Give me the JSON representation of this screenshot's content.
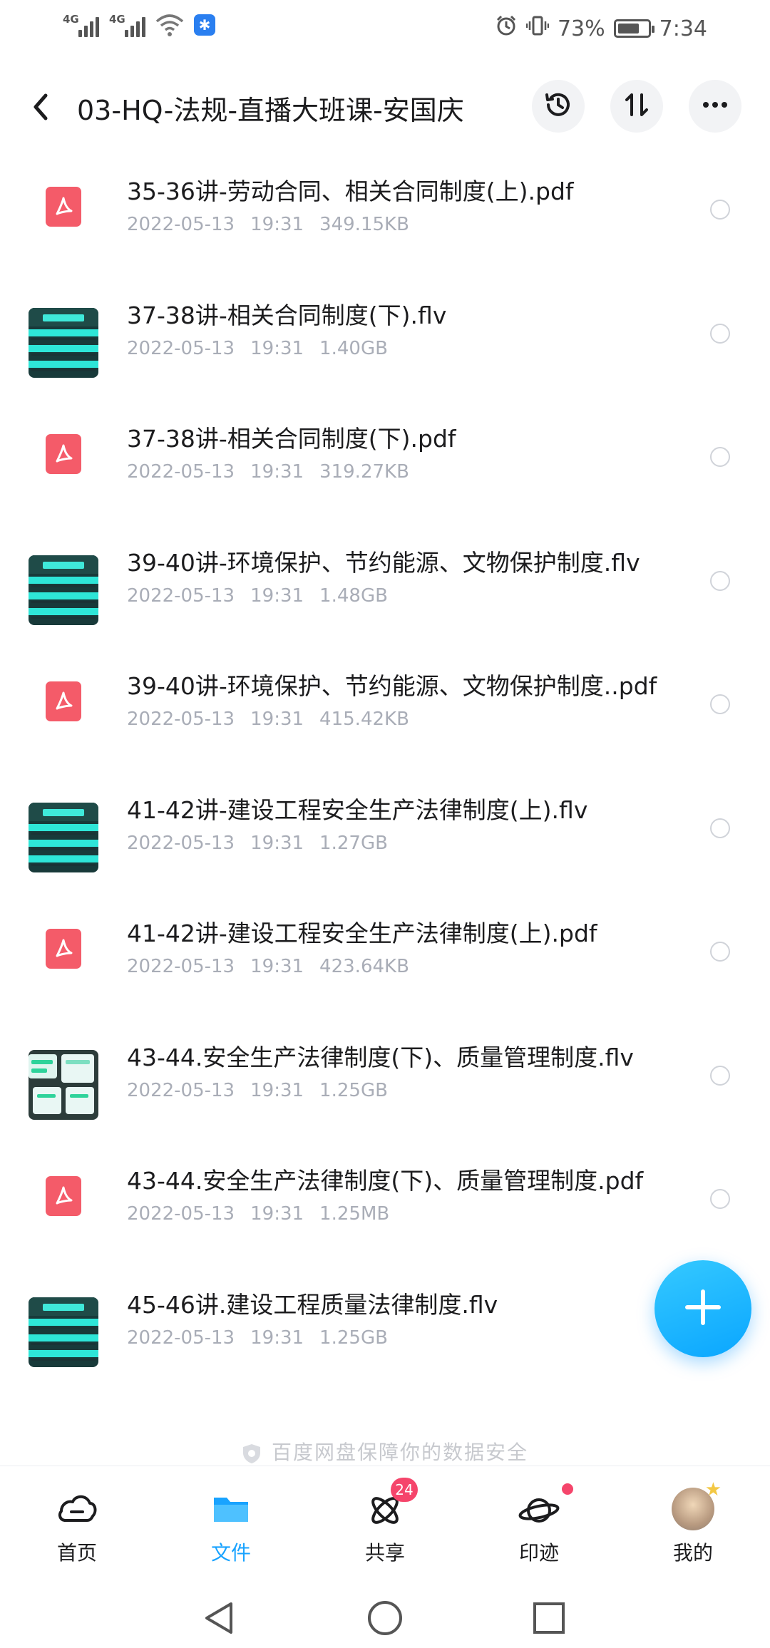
{
  "status_bar": {
    "network_1": "4G",
    "network_2": "4G",
    "battery_percent": "73%",
    "battery_level": 0.73,
    "time": "7:34"
  },
  "header": {
    "title": "03-HQ-法规-直播大班课-安国庆",
    "icons": [
      "back-icon",
      "history-icon",
      "sort-icon",
      "more-icon"
    ]
  },
  "files": [
    {
      "name": "35-36讲-劳动合同、相关合同制度(上).pdf",
      "date": "2022-05-13",
      "time": "19:31",
      "size": "349.15KB",
      "type": "pdf"
    },
    {
      "name": "37-38讲-相关合同制度(下).flv",
      "date": "2022-05-13",
      "time": "19:31",
      "size": "1.40GB",
      "type": "video"
    },
    {
      "name": "37-38讲-相关合同制度(下).pdf",
      "date": "2022-05-13",
      "time": "19:31",
      "size": "319.27KB",
      "type": "pdf"
    },
    {
      "name": "39-40讲-环境保护、节约能源、文物保护制度.flv",
      "date": "2022-05-13",
      "time": "19:31",
      "size": "1.48GB",
      "type": "video"
    },
    {
      "name": "39-40讲-环境保护、节约能源、文物保护制度..pdf",
      "date": "2022-05-13",
      "time": "19:31",
      "size": "415.42KB",
      "type": "pdf"
    },
    {
      "name": "41-42讲-建设工程安全生产法律制度(上).flv",
      "date": "2022-05-13",
      "time": "19:31",
      "size": "1.27GB",
      "type": "video"
    },
    {
      "name": "41-42讲-建设工程安全生产法律制度(上).pdf",
      "date": "2022-05-13",
      "time": "19:31",
      "size": "423.64KB",
      "type": "pdf"
    },
    {
      "name": "43-44.安全生产法律制度(下)、质量管理制度.flv",
      "date": "2022-05-13",
      "time": "19:31",
      "size": "1.25GB",
      "type": "video2"
    },
    {
      "name": "43-44.安全生产法律制度(下)、质量管理制度.pdf",
      "date": "2022-05-13",
      "time": "19:31",
      "size": "1.25MB",
      "type": "pdf"
    },
    {
      "name": "45-46讲.建设工程质量法律制度.flv",
      "date": "2022-05-13",
      "time": "19:31",
      "size": "1.25GB",
      "type": "video"
    }
  ],
  "footer": {
    "safety_text": "百度网盘保障你的数据安全"
  },
  "bottom_nav": {
    "items": [
      {
        "label": "首页",
        "icon": "cloud-icon"
      },
      {
        "label": "文件",
        "icon": "folder-icon",
        "active": true
      },
      {
        "label": "共享",
        "icon": "atom-icon",
        "badge": "24"
      },
      {
        "label": "印迹",
        "icon": "planet-icon"
      },
      {
        "label": "我的",
        "icon": "avatar"
      }
    ]
  },
  "colors": {
    "accent": "#19a3ff",
    "pdf": "#f45b69",
    "badge": "#f5456b"
  }
}
